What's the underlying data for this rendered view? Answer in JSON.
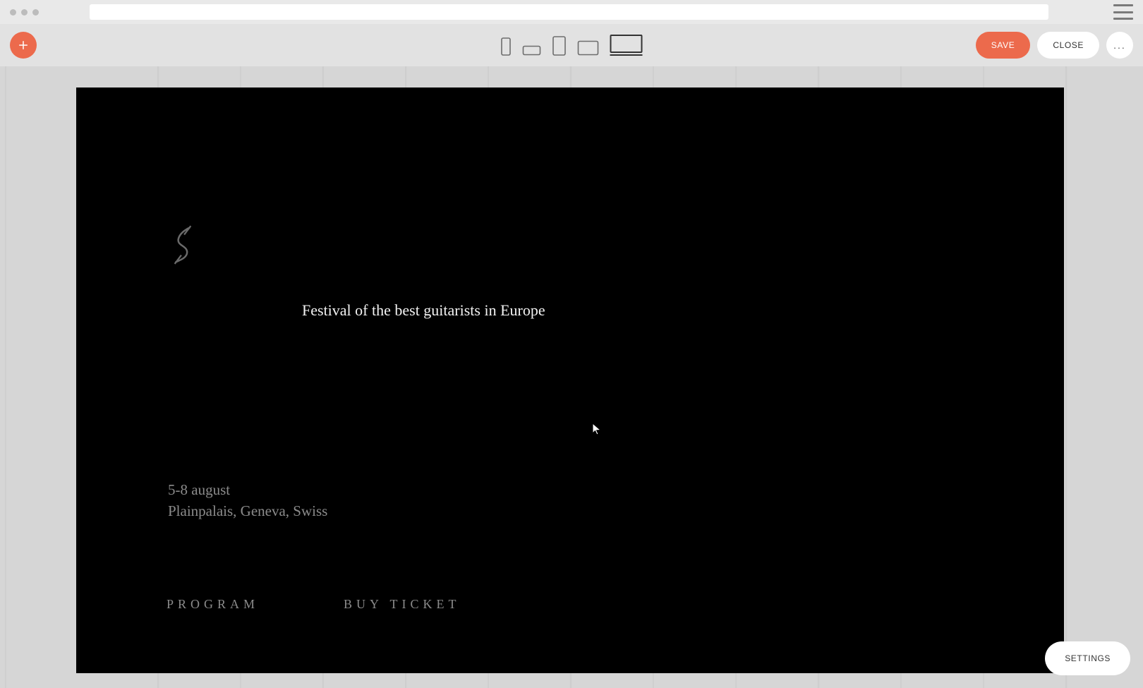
{
  "toolbar": {
    "save_label": "SAVE",
    "close_label": "CLOSE",
    "more_label": "..."
  },
  "viewports": {
    "items": [
      "phone-portrait",
      "phone-landscape",
      "tablet-portrait",
      "tablet-landscape",
      "desktop"
    ],
    "active": "desktop"
  },
  "hero": {
    "headline": "Festival of the best guitarists in Europe",
    "meta_line1": "5-8 august",
    "meta_line2": "Plainpalais, Geneva, Swiss",
    "links": {
      "program": "PROGRAM",
      "buy_ticket": "BUY TICKET"
    }
  },
  "floating": {
    "settings_label": "SETTINGS"
  },
  "colors": {
    "accent": "#ec6a4c",
    "page_bg": "#000000",
    "editor_bg": "#e2e2e2"
  }
}
